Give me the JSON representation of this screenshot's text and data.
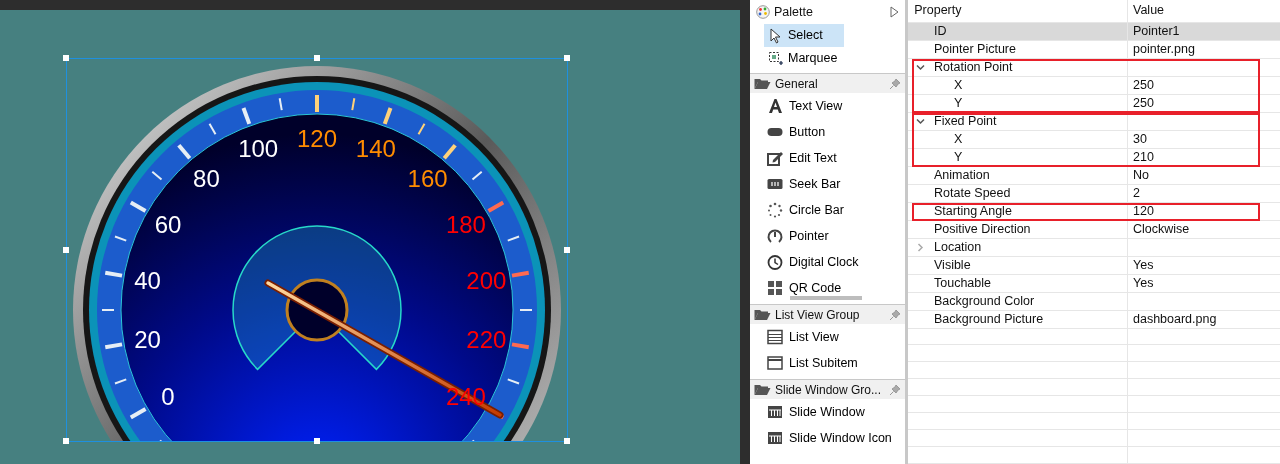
{
  "canvas": {
    "dial_labels": [
      {
        "text": "0",
        "color": "#ffffff"
      },
      {
        "text": "20",
        "color": "#ffffff"
      },
      {
        "text": "40",
        "color": "#ffffff"
      },
      {
        "text": "60",
        "color": "#ffffff"
      },
      {
        "text": "80",
        "color": "#ffffff"
      },
      {
        "text": "100",
        "color": "#ffffff"
      },
      {
        "text": "120",
        "color": "#ff8c00"
      },
      {
        "text": "140",
        "color": "#ff8c00"
      },
      {
        "text": "160",
        "color": "#ff8c00"
      },
      {
        "text": "180",
        "color": "#ff0000"
      },
      {
        "text": "200",
        "color": "#ff0000"
      },
      {
        "text": "220",
        "color": "#ff0000"
      },
      {
        "text": "240",
        "color": "#ff0000"
      }
    ]
  },
  "palette": {
    "title": "Palette",
    "tools": [
      {
        "label": "Select",
        "kind": "select",
        "selected": true
      },
      {
        "label": "Marquee",
        "kind": "marquee",
        "selected": false
      }
    ],
    "groups": [
      {
        "title": "General",
        "items": [
          {
            "label": "Text View",
            "kind": "text"
          },
          {
            "label": "Button",
            "kind": "button"
          },
          {
            "label": "Edit Text",
            "kind": "edit"
          },
          {
            "label": "Seek Bar",
            "kind": "seekbar"
          },
          {
            "label": "Circle Bar",
            "kind": "circlebar"
          },
          {
            "label": "Pointer",
            "kind": "pointer"
          },
          {
            "label": "Digital Clock",
            "kind": "clock"
          },
          {
            "label": "QR Code",
            "kind": "qrcode"
          }
        ]
      },
      {
        "title": "List View Group",
        "items": [
          {
            "label": "List View",
            "kind": "listview"
          },
          {
            "label": "List Subitem",
            "kind": "subitem"
          }
        ]
      },
      {
        "title": "Slide Window Gro...",
        "items": [
          {
            "label": "Slide Window",
            "kind": "slidewindow"
          },
          {
            "label": "Slide Window Icon",
            "kind": "slidewindow"
          }
        ]
      }
    ]
  },
  "properties": {
    "columns": [
      "Property",
      "Value"
    ],
    "rows": [
      {
        "name": "ID",
        "value": "Pointer1",
        "selected": true,
        "highlighted": false
      },
      {
        "name": "Pointer Picture",
        "value": "pointer.png",
        "selected": false,
        "highlighted": false
      },
      {
        "name": "Rotation Point",
        "selected": false,
        "highlighted": true,
        "expanded": true,
        "children": [
          {
            "name": "X",
            "value": "250",
            "selected": false
          },
          {
            "name": "Y",
            "value": "250",
            "selected": false
          }
        ]
      },
      {
        "name": "Fixed Point",
        "selected": false,
        "highlighted": true,
        "expanded": true,
        "children": [
          {
            "name": "X",
            "value": "30",
            "selected": false
          },
          {
            "name": "Y",
            "value": "210",
            "selected": false
          }
        ]
      },
      {
        "name": "Animation",
        "value": "No",
        "selected": false,
        "highlighted": false
      },
      {
        "name": "Rotate Speed",
        "value": "2",
        "selected": false,
        "highlighted": false
      },
      {
        "name": "Starting Angle",
        "value": "120",
        "selected": false,
        "highlighted": true
      },
      {
        "name": "Positive Direction",
        "value": "Clockwise",
        "selected": false,
        "highlighted": false
      },
      {
        "name": "Location",
        "selected": false,
        "highlighted": false,
        "expanded": false,
        "children": []
      },
      {
        "name": "Visible",
        "value": "Yes",
        "selected": false,
        "highlighted": false
      },
      {
        "name": "Touchable",
        "value": "Yes",
        "selected": false,
        "highlighted": false
      },
      {
        "name": "Background Color",
        "selected": false,
        "highlighted": false
      },
      {
        "name": "Background Picture",
        "value": "dashboard.png",
        "selected": false,
        "highlighted": false
      }
    ]
  }
}
